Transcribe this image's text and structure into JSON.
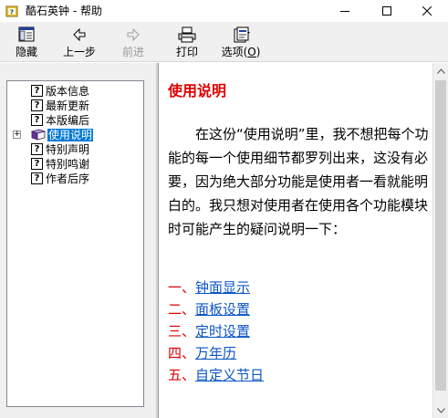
{
  "window": {
    "title": "酷石英钟 - 帮助",
    "app_icon": "help-book-icon",
    "controls": [
      "minimize-icon",
      "maximize-icon",
      "close-icon"
    ]
  },
  "toolbar": {
    "hide_label": "隐藏",
    "back_label": "上一步",
    "forward_label": "前进",
    "print_label": "打印",
    "options_label_main": "选项(",
    "options_label_key": "O",
    "options_label_end": ")"
  },
  "nav": {
    "items": [
      {
        "label": "版本信息",
        "icon": "help-topic-icon"
      },
      {
        "label": "最新更新",
        "icon": "help-topic-icon"
      },
      {
        "label": "本版编后",
        "icon": "help-topic-icon"
      },
      {
        "label": "使用说明",
        "icon": "closed-book-icon",
        "selected": true,
        "expander": "+"
      },
      {
        "label": "特别声明",
        "icon": "help-topic-icon"
      },
      {
        "label": "特别鸣谢",
        "icon": "help-topic-icon"
      },
      {
        "label": "作者后序",
        "icon": "help-topic-icon"
      }
    ],
    "q_glyph": "?"
  },
  "content": {
    "title": "使用说明",
    "paragraph": "在这份“使用说明”里，我不想把每个功能的每一个使用细节都罗列出来，这没有必要，因为绝大部分功能是使用者一看就能明白的。我只想对使用者在使用各个功能模块时可能产生的疑问说明一下：",
    "links": [
      {
        "num": "一、",
        "text": "钟面显示"
      },
      {
        "num": "二、",
        "text": "面板设置"
      },
      {
        "num": "三、",
        "text": "定时设置"
      },
      {
        "num": "四、",
        "text": "万年历"
      },
      {
        "num": "五、",
        "text": "自定义节日"
      }
    ]
  },
  "colors": {
    "title_red": "#e00000",
    "link_blue": "#0b55c4",
    "selection_blue": "#0078d7"
  }
}
